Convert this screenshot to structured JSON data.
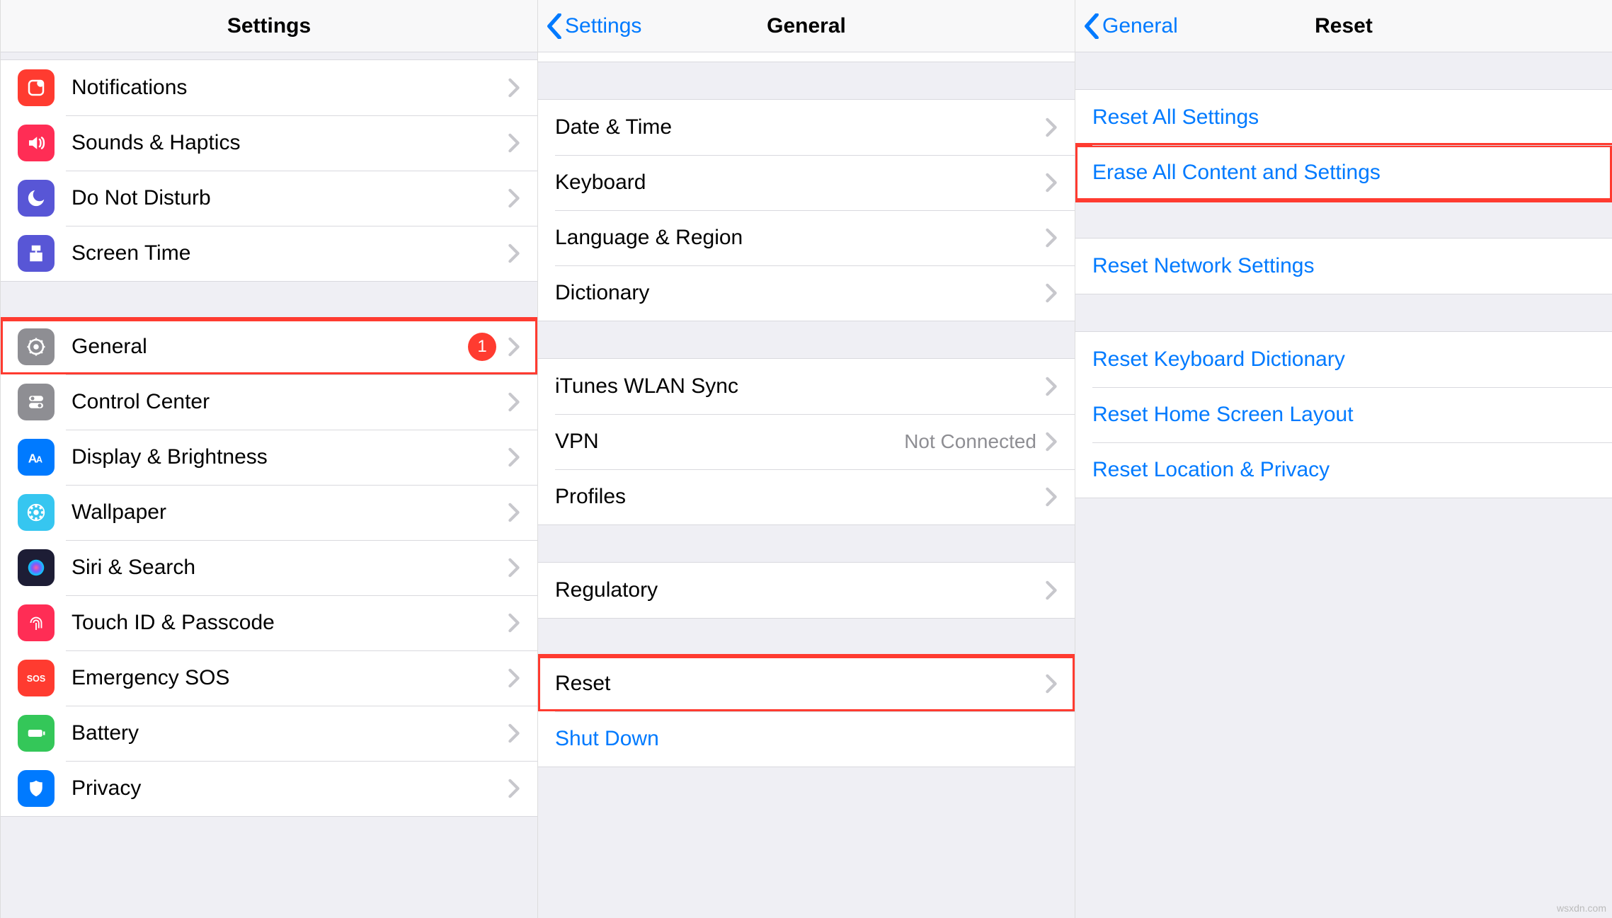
{
  "panel1": {
    "title": "Settings",
    "group1": [
      {
        "label": "Notifications",
        "icon": "notifications",
        "color": "#ff3b30"
      },
      {
        "label": "Sounds & Haptics",
        "icon": "sounds",
        "color": "#ff2d55"
      },
      {
        "label": "Do Not Disturb",
        "icon": "dnd",
        "color": "#5856d6"
      },
      {
        "label": "Screen Time",
        "icon": "screentime",
        "color": "#5856d6"
      }
    ],
    "group2": [
      {
        "label": "General",
        "icon": "general",
        "color": "#8e8e93",
        "badge": "1",
        "highlight": true
      },
      {
        "label": "Control Center",
        "icon": "controlcenter",
        "color": "#8e8e93"
      },
      {
        "label": "Display & Brightness",
        "icon": "display",
        "color": "#007aff"
      },
      {
        "label": "Wallpaper",
        "icon": "wallpaper",
        "color": "#36c6f0"
      },
      {
        "label": "Siri & Search",
        "icon": "siri",
        "color": "#1d1d35"
      },
      {
        "label": "Touch ID & Passcode",
        "icon": "touchid",
        "color": "#ff2d55"
      },
      {
        "label": "Emergency SOS",
        "icon": "sos",
        "color": "#ff3b30"
      },
      {
        "label": "Battery",
        "icon": "battery",
        "color": "#34c759"
      },
      {
        "label": "Privacy",
        "icon": "privacy",
        "color": "#007aff"
      }
    ]
  },
  "panel2": {
    "back": "Settings",
    "title": "General",
    "group1": [
      {
        "label": "Date & Time"
      },
      {
        "label": "Keyboard"
      },
      {
        "label": "Language & Region"
      },
      {
        "label": "Dictionary"
      }
    ],
    "group2": [
      {
        "label": "iTunes WLAN Sync"
      },
      {
        "label": "VPN",
        "value": "Not Connected"
      },
      {
        "label": "Profiles"
      }
    ],
    "group3": [
      {
        "label": "Regulatory"
      }
    ],
    "group4": [
      {
        "label": "Reset",
        "highlight": true
      },
      {
        "label": "Shut Down",
        "link": true,
        "nochevron": true
      }
    ]
  },
  "panel3": {
    "back": "General",
    "title": "Reset",
    "group1": [
      {
        "label": "Reset All Settings",
        "link": true
      },
      {
        "label": "Erase All Content and Settings",
        "link": true,
        "highlight": true
      }
    ],
    "group2": [
      {
        "label": "Reset Network Settings",
        "link": true
      }
    ],
    "group3": [
      {
        "label": "Reset Keyboard Dictionary",
        "link": true
      },
      {
        "label": "Reset Home Screen Layout",
        "link": true
      },
      {
        "label": "Reset Location & Privacy",
        "link": true
      }
    ]
  },
  "watermark": "wsxdn.com"
}
